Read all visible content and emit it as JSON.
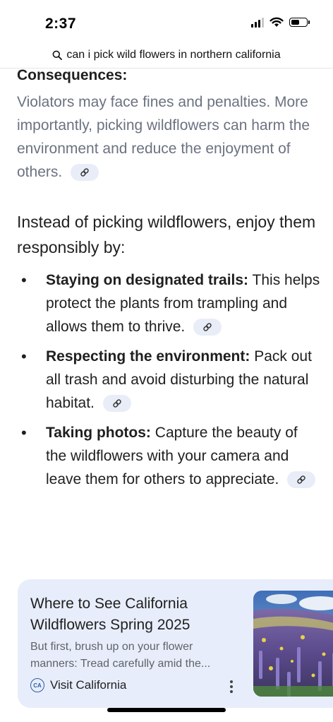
{
  "status_bar": {
    "time": "2:37"
  },
  "search": {
    "query": "can i pick wild flowers in northern california"
  },
  "answer": {
    "consequences_title": "Consequences:",
    "consequences_text": "Violators may face fines and penalties. More importantly, picking wildflowers can harm the environment and reduce the enjoyment of others.",
    "heading": "Instead of picking wildflowers, enjoy them responsibly by:",
    "tips": [
      {
        "bold": "Staying on designated trails:",
        "text": " This helps protect the plants from trampling and allows them to thrive."
      },
      {
        "bold": "Respecting the environment:",
        "text": " Pack out all trash and avoid disturbing the natural habitat."
      },
      {
        "bold": "Taking photos:",
        "text": " Capture the beauty of the wildflowers with your camera and leave them for others to appreciate."
      }
    ]
  },
  "card": {
    "title": "Where to See California Wildflowers Spring 2025",
    "snippet": "But first, brush up on your flower manners: Tread carefully amid the...",
    "source": "Visit California",
    "source_logo_text": "CA"
  },
  "icons": {
    "search": "search-icon",
    "link": "link-icon",
    "wifi": "wifi-icon",
    "battery": "battery-icon",
    "more": "more-vert-icon"
  },
  "colors": {
    "link_chip": "#e8edf7",
    "card_bg": "#e8edfb",
    "faded_text": "#6b7280"
  }
}
